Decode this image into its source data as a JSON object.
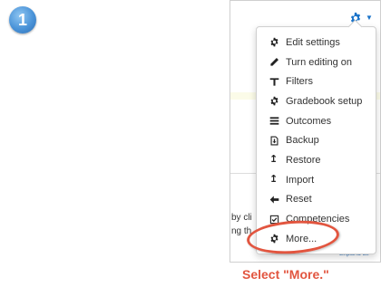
{
  "step": {
    "number": "1"
  },
  "background": {
    "line1": "by cli",
    "line2": "ng th",
    "link": "Expand all"
  },
  "menu": {
    "items": [
      {
        "label": "Edit settings",
        "icon": "gear-icon"
      },
      {
        "label": "Turn editing on",
        "icon": "pencil-icon"
      },
      {
        "label": "Filters",
        "icon": "filter-icon"
      },
      {
        "label": "Gradebook setup",
        "icon": "gear-icon"
      },
      {
        "label": "Outcomes",
        "icon": "list-icon"
      },
      {
        "label": "Backup",
        "icon": "download-file-icon"
      },
      {
        "label": "Restore",
        "icon": "upload-arrow-icon"
      },
      {
        "label": "Import",
        "icon": "upload-arrow-icon"
      },
      {
        "label": "Reset",
        "icon": "left-arrow-icon"
      },
      {
        "label": "Competencies",
        "icon": "checkbox-icon"
      },
      {
        "label": "More...",
        "icon": "gear-icon"
      }
    ]
  },
  "caption": "Select \"More.\"",
  "colors": {
    "accent": "#1a73c9",
    "highlight": "#e2553f",
    "badge": "#4a93d8"
  }
}
